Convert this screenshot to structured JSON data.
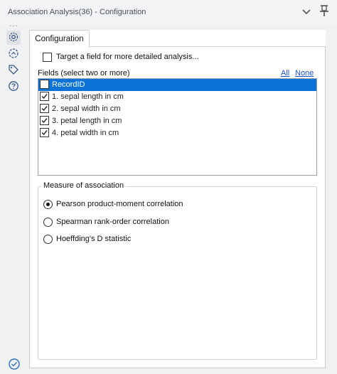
{
  "window": {
    "title": "Association Analysis(36) - Configuration"
  },
  "sidebar": {
    "items": [
      {
        "name": "configuration",
        "icon": "gear-icon",
        "active": true
      },
      {
        "name": "annotation",
        "icon": "annotation-icon",
        "active": false
      },
      {
        "name": "tag",
        "icon": "tag-icon",
        "active": false
      },
      {
        "name": "help",
        "icon": "help-icon",
        "active": false
      }
    ]
  },
  "tabs": [
    {
      "label": "Configuration",
      "active": true
    }
  ],
  "target_field": {
    "label": "Target a field for more detailed analysis...",
    "checked": false
  },
  "fields": {
    "label": "Fields (select two or more)",
    "all_link": "All",
    "none_link": "None",
    "items": [
      {
        "label": "RecordID",
        "checked": false,
        "selected": true
      },
      {
        "label": "1. sepal length in cm",
        "checked": true,
        "selected": false
      },
      {
        "label": "2. sepal width in cm",
        "checked": true,
        "selected": false
      },
      {
        "label": "3. petal length in cm",
        "checked": true,
        "selected": false
      },
      {
        "label": "4. petal width in cm",
        "checked": true,
        "selected": false
      }
    ]
  },
  "measure": {
    "legend": "Measure of association",
    "options": [
      {
        "label": "Pearson product-moment correlation",
        "selected": true
      },
      {
        "label": "Spearman rank-order correlation",
        "selected": false
      },
      {
        "label": "Hoeffding's D statistic",
        "selected": false
      }
    ]
  },
  "colors": {
    "accent": "#0b72d6",
    "link": "#1a4fd6",
    "status_ok": "#2f6fbf"
  }
}
